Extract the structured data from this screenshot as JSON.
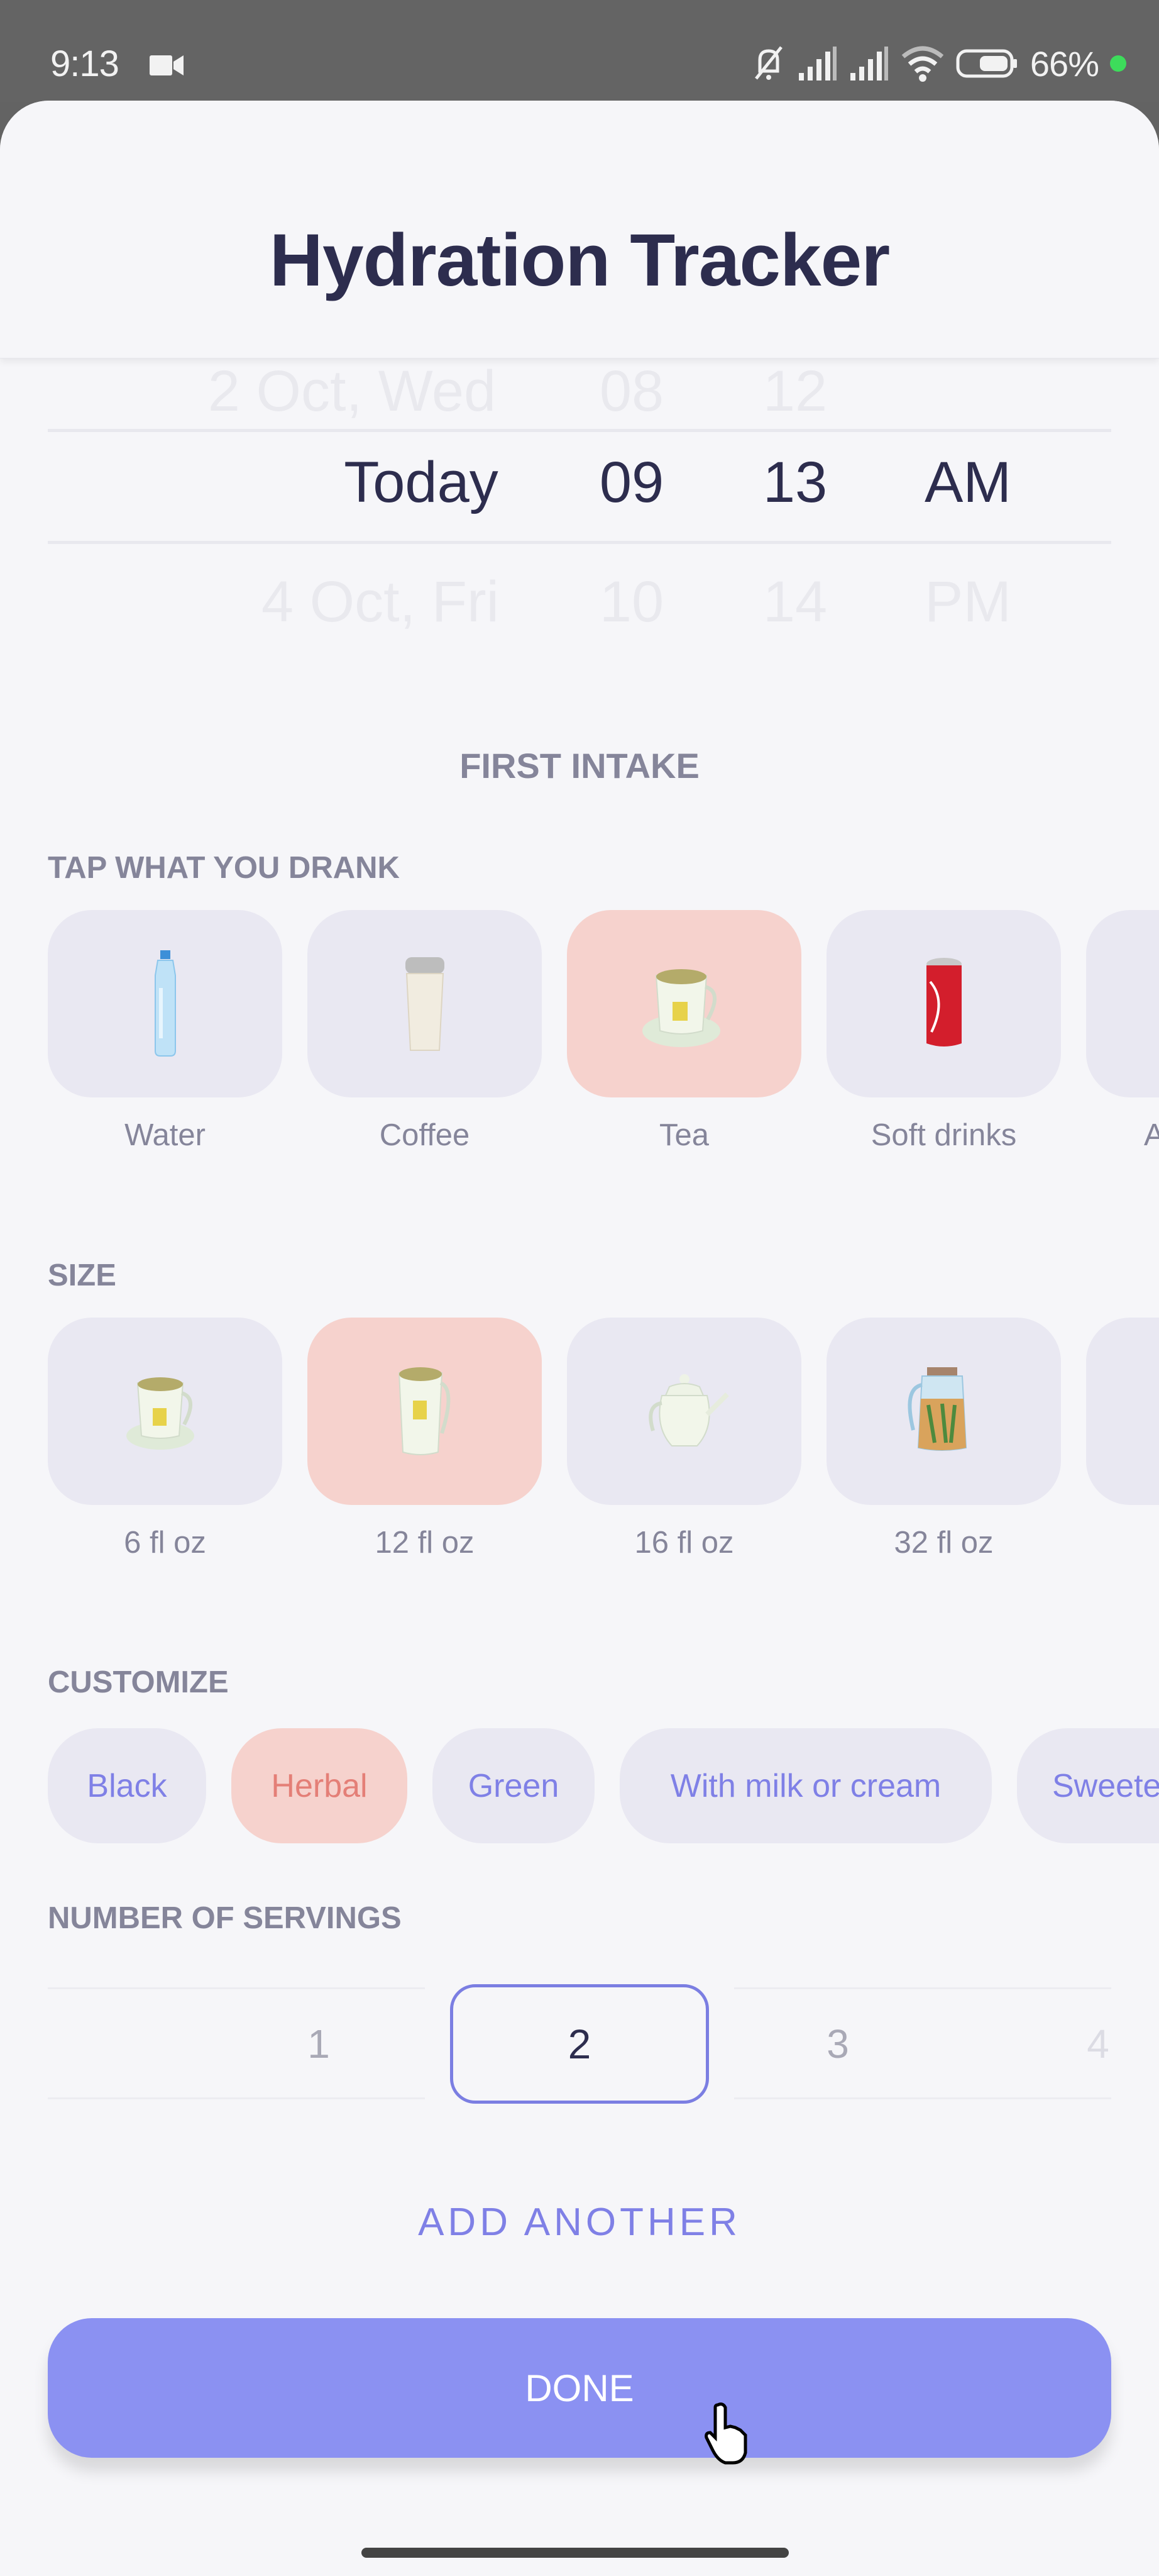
{
  "status_bar": {
    "time": "9:13",
    "battery_percent": "66%",
    "icons": [
      "video-camera-icon",
      "mute-icon",
      "signal-icon",
      "signal-icon",
      "wifi-icon",
      "battery-icon",
      "privacy-dot-icon"
    ]
  },
  "header": {
    "title": "Hydration Tracker"
  },
  "time_picker": {
    "rows": [
      {
        "day": "2 Oct, Wed",
        "hour": "08",
        "minute": "12",
        "period": ""
      },
      {
        "day": "Today",
        "hour": "09",
        "minute": "13",
        "period": "AM"
      },
      {
        "day": "4 Oct, Fri",
        "hour": "10",
        "minute": "14",
        "period": "PM"
      }
    ],
    "selected_index": 1
  },
  "intake_heading": "FIRST INTAKE",
  "drinks": {
    "label": "TAP WHAT YOU DRANK",
    "items": [
      {
        "label": "Water",
        "icon": "water-bottle-icon",
        "selected": false
      },
      {
        "label": "Coffee",
        "icon": "coffee-cup-icon",
        "selected": false
      },
      {
        "label": "Tea",
        "icon": "tea-cup-icon",
        "selected": true
      },
      {
        "label": "Soft drinks",
        "icon": "soda-can-icon",
        "selected": false
      },
      {
        "label": "A",
        "icon": "",
        "selected": false
      }
    ]
  },
  "size": {
    "label": "SIZE",
    "items": [
      {
        "label": "6 fl oz",
        "icon": "teacup-saucer-icon",
        "selected": false
      },
      {
        "label": "12 fl oz",
        "icon": "tea-mug-icon",
        "selected": true
      },
      {
        "label": "16 fl oz",
        "icon": "teapot-icon",
        "selected": false
      },
      {
        "label": "32 fl oz",
        "icon": "tea-pitcher-icon",
        "selected": false
      },
      {
        "label": "",
        "icon": "",
        "selected": false
      }
    ]
  },
  "customize": {
    "label": "CUSTOMIZE",
    "chips": [
      {
        "label": "Black",
        "selected": false
      },
      {
        "label": "Herbal",
        "selected": true
      },
      {
        "label": "Green",
        "selected": false
      },
      {
        "label": "With milk or cream",
        "selected": false
      },
      {
        "label": "Sweete",
        "selected": false
      }
    ]
  },
  "servings": {
    "label": "NUMBER OF SERVINGS",
    "options": [
      "1",
      "2",
      "3",
      "4"
    ],
    "selected": "2"
  },
  "add_another_label": "ADD ANOTHER",
  "done_label": "DONE",
  "colors": {
    "accent": "#8b91f2",
    "accent_text": "#7f80e6",
    "selected_bg": "#f6d2cd",
    "selected_text": "#e47f77",
    "tile_bg": "#e9e8f2",
    "title": "#2d2d4e"
  }
}
